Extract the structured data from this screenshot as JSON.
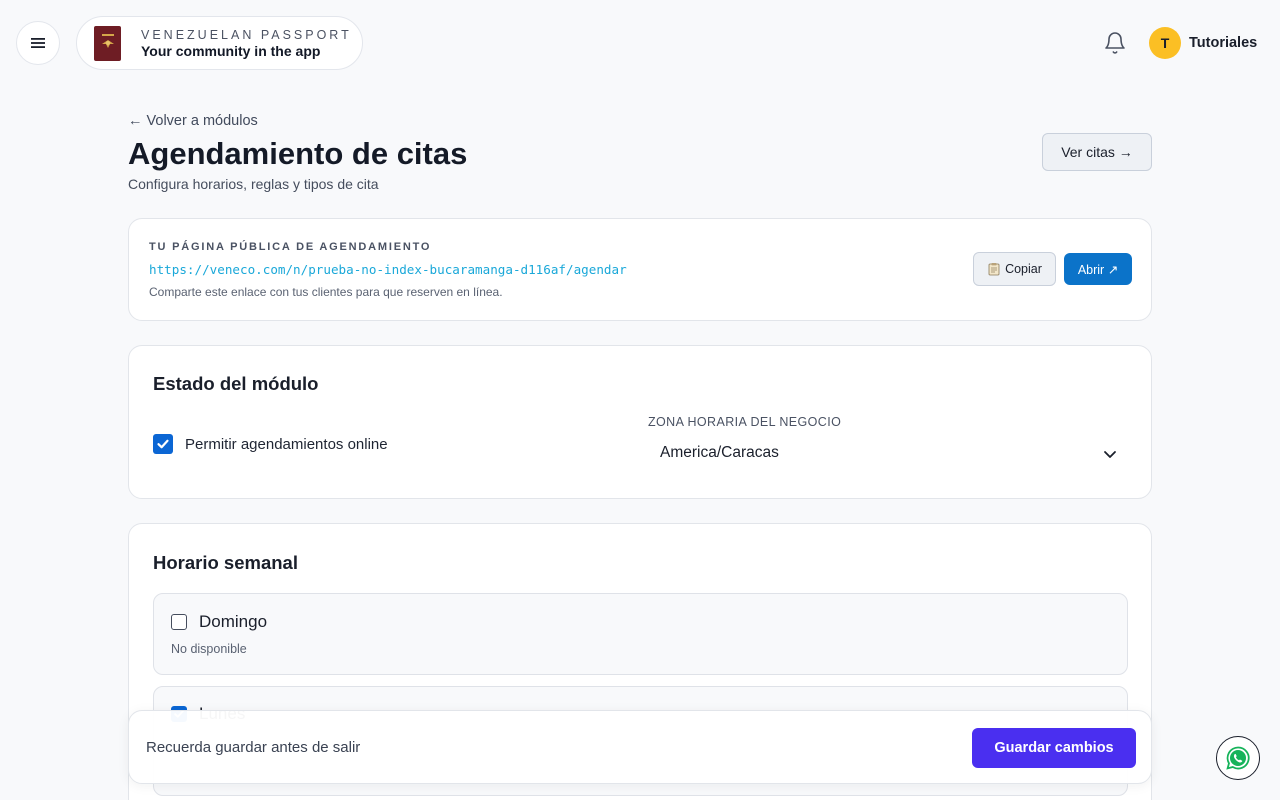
{
  "header": {
    "brand_subtitle": "VENEZUELAN PASSPORT",
    "brand_title": "Your community in the app",
    "user_initial": "T",
    "user_name": "Tutoriales"
  },
  "page": {
    "back_label": "← Volver a módulos",
    "title": "Agendamiento de citas",
    "subtitle": "Configura horarios, reglas y tipos de cita",
    "ver_citas_label": "Ver citas →"
  },
  "public_page": {
    "label": "TU PÁGINA PÚBLICA DE AGENDAMIENTO",
    "url": "https://veneco.com/n/prueba-no-index-bucaramanga-d116af/agendar",
    "note": "Comparte este enlace con tus clientes para que reserven en línea.",
    "copy_label": "Copiar",
    "open_label": "Abrir ↗"
  },
  "status": {
    "title": "Estado del módulo",
    "online_label": "Permitir agendamientos online",
    "online_checked": true,
    "timezone_label": "ZONA HORARIA DEL NEGOCIO",
    "timezone_value": "America/Caracas"
  },
  "weekly": {
    "title": "Horario semanal",
    "days": [
      {
        "name": "Domingo",
        "enabled": false,
        "status": "No disponible"
      },
      {
        "name": "Lunes",
        "enabled": true
      }
    ]
  },
  "save_bar": {
    "note": "Recuerda guardar antes de salir",
    "save_label": "Guardar cambios"
  },
  "colors": {
    "primary": "#4a2ff0",
    "link": "#1aa8d9",
    "open_button": "#0b73c9",
    "avatar": "#fbbf24"
  }
}
